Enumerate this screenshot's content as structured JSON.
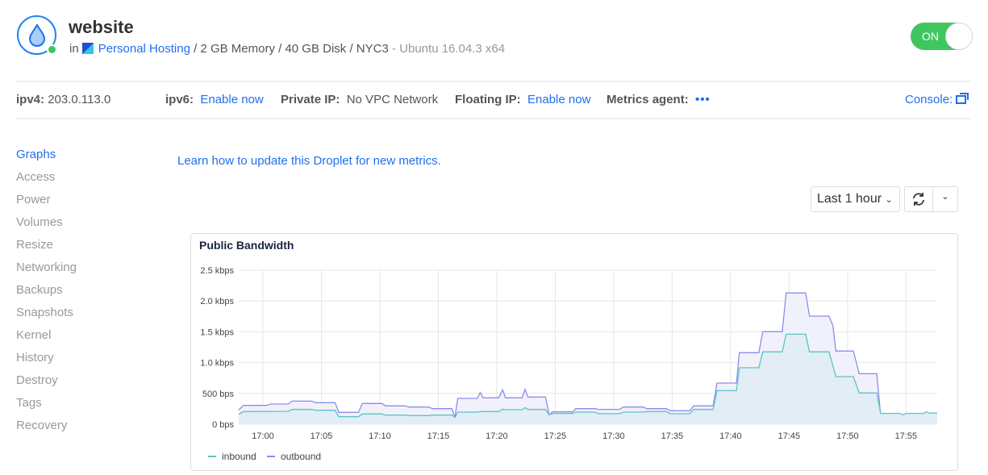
{
  "droplet": {
    "name": "website",
    "in_label": "in",
    "project": "Personal Hosting",
    "specs": "/ 2 GB Memory / 40 GB Disk / NYC3",
    "os": "- Ubuntu 16.04.3 x64",
    "power_toggle": "ON",
    "status_color": "#3fc65f"
  },
  "info": {
    "ipv4_label": "ipv4:",
    "ipv4": "203.0.113.0",
    "ipv6_label": "ipv6:",
    "ipv6_action": "Enable now",
    "private_label": "Private IP:",
    "private_value": "No VPC Network",
    "floating_label": "Floating IP:",
    "floating_action": "Enable now",
    "metrics_label": "Metrics agent:",
    "metrics_value": "•••",
    "console_label": "Console:"
  },
  "sidebar": {
    "items": [
      {
        "label": "Graphs",
        "active": true
      },
      {
        "label": "Access"
      },
      {
        "label": "Power"
      },
      {
        "label": "Volumes"
      },
      {
        "label": "Resize"
      },
      {
        "label": "Networking"
      },
      {
        "label": "Backups"
      },
      {
        "label": "Snapshots"
      },
      {
        "label": "Kernel"
      },
      {
        "label": "History"
      },
      {
        "label": "Destroy"
      },
      {
        "label": "Tags"
      },
      {
        "label": "Recovery"
      }
    ]
  },
  "main": {
    "learn_link": "Learn how to update this Droplet for new metrics.",
    "time_range": "Last 1 hour"
  },
  "chart_data": {
    "type": "area",
    "title": "Public Bandwidth",
    "grid": true,
    "legend": "bottom-left",
    "ylim": [
      0,
      2500
    ],
    "yticks": [
      0,
      500,
      1000,
      1500,
      2000,
      2500
    ],
    "ytick_labels": [
      "0 bps",
      "500 bps",
      "1.0 kbps",
      "1.5 kbps",
      "2.0 kbps",
      "2.5 kbps"
    ],
    "xlim": [
      "16:57:56",
      "17:57:40"
    ],
    "xticks": [
      "17:00",
      "17:05",
      "17:10",
      "17:15",
      "17:20",
      "17:25",
      "17:30",
      "17:35",
      "17:40",
      "17:45",
      "17:50",
      "17:55"
    ],
    "series": [
      {
        "name": "outbound",
        "color": "#8c8cf0",
        "fill": "#f1f1fb",
        "points": [
          [
            "16:57:56",
            231
          ],
          [
            "16:58:20",
            305
          ],
          [
            "17:00:20",
            305
          ],
          [
            "17:00:40",
            327
          ],
          [
            "17:02:10",
            327
          ],
          [
            "17:02:30",
            375
          ],
          [
            "17:04:10",
            375
          ],
          [
            "17:04:30",
            349
          ],
          [
            "17:06:10",
            349
          ],
          [
            "17:06:30",
            192
          ],
          [
            "17:08:10",
            192
          ],
          [
            "17:08:30",
            336
          ],
          [
            "17:10:10",
            336
          ],
          [
            "17:10:30",
            297
          ],
          [
            "17:12:10",
            297
          ],
          [
            "17:12:30",
            279
          ],
          [
            "17:14:10",
            279
          ],
          [
            "17:14:30",
            253
          ],
          [
            "17:16:10",
            253
          ],
          [
            "17:16:25",
            110
          ],
          [
            "17:16:40",
            419
          ],
          [
            "17:18:20",
            419
          ],
          [
            "17:18:35",
            515
          ],
          [
            "17:18:50",
            428
          ],
          [
            "17:20:10",
            428
          ],
          [
            "17:20:30",
            558
          ],
          [
            "17:20:45",
            428
          ],
          [
            "17:22:10",
            428
          ],
          [
            "17:22:25",
            565
          ],
          [
            "17:22:40",
            441
          ],
          [
            "17:24:10",
            441
          ],
          [
            "17:24:30",
            144
          ],
          [
            "17:24:45",
            200
          ],
          [
            "17:26:30",
            200
          ],
          [
            "17:26:45",
            253
          ],
          [
            "17:28:25",
            253
          ],
          [
            "17:28:40",
            241
          ],
          [
            "17:30:30",
            241
          ],
          [
            "17:30:50",
            279
          ],
          [
            "17:32:30",
            279
          ],
          [
            "17:32:50",
            253
          ],
          [
            "17:34:30",
            253
          ],
          [
            "17:34:50",
            218
          ],
          [
            "17:36:30",
            218
          ],
          [
            "17:36:50",
            297
          ],
          [
            "17:38:30",
            297
          ],
          [
            "17:38:50",
            667
          ],
          [
            "17:40:30",
            667
          ],
          [
            "17:40:45",
            1161
          ],
          [
            "17:42:25",
            1161
          ],
          [
            "17:42:45",
            1501
          ],
          [
            "17:44:25",
            1501
          ],
          [
            "17:44:45",
            2129
          ],
          [
            "17:46:25",
            2129
          ],
          [
            "17:46:45",
            1754
          ],
          [
            "17:48:25",
            1754
          ],
          [
            "17:48:45",
            1600
          ],
          [
            "17:49:00",
            1187
          ],
          [
            "17:50:30",
            1187
          ],
          [
            "17:51:00",
            820
          ],
          [
            "17:52:30",
            820
          ],
          [
            "17:52:50",
            135
          ],
          [
            "17:54:30",
            135
          ],
          [
            "17:54:45",
            65
          ],
          [
            "17:55:00",
            100
          ],
          [
            "17:56:30",
            100
          ],
          [
            "17:56:45",
            135
          ],
          [
            "17:57:40",
            135
          ]
        ]
      },
      {
        "name": "inbound",
        "color": "#5cc5c0",
        "fill": "#e2edf5",
        "points": [
          [
            "16:57:56",
            160
          ],
          [
            "16:58:20",
            205
          ],
          [
            "17:02:10",
            210
          ],
          [
            "17:02:30",
            240
          ],
          [
            "17:04:10",
            240
          ],
          [
            "17:04:30",
            227
          ],
          [
            "17:06:10",
            227
          ],
          [
            "17:06:30",
            122
          ],
          [
            "17:08:10",
            122
          ],
          [
            "17:08:30",
            166
          ],
          [
            "17:10:10",
            166
          ],
          [
            "17:10:30",
            148
          ],
          [
            "17:12:10",
            148
          ],
          [
            "17:12:30",
            140
          ],
          [
            "17:14:10",
            140
          ],
          [
            "17:14:30",
            148
          ],
          [
            "17:16:10",
            148
          ],
          [
            "17:16:25",
            110
          ],
          [
            "17:16:40",
            196
          ],
          [
            "17:18:20",
            196
          ],
          [
            "17:18:40",
            205
          ],
          [
            "17:20:10",
            205
          ],
          [
            "17:20:30",
            245
          ],
          [
            "17:20:45",
            235
          ],
          [
            "17:22:10",
            235
          ],
          [
            "17:22:25",
            270
          ],
          [
            "17:22:40",
            240
          ],
          [
            "17:24:10",
            240
          ],
          [
            "17:24:30",
            150
          ],
          [
            "17:24:45",
            175
          ],
          [
            "17:26:30",
            175
          ],
          [
            "17:26:45",
            196
          ],
          [
            "17:28:25",
            196
          ],
          [
            "17:28:40",
            170
          ],
          [
            "17:30:30",
            170
          ],
          [
            "17:30:50",
            196
          ],
          [
            "17:32:30",
            196
          ],
          [
            "17:32:50",
            205
          ],
          [
            "17:34:30",
            205
          ],
          [
            "17:34:50",
            170
          ],
          [
            "17:36:30",
            170
          ],
          [
            "17:36:50",
            240
          ],
          [
            "17:38:30",
            240
          ],
          [
            "17:38:50",
            545
          ],
          [
            "17:40:30",
            545
          ],
          [
            "17:40:45",
            916
          ],
          [
            "17:42:25",
            916
          ],
          [
            "17:42:45",
            1174
          ],
          [
            "17:44:25",
            1174
          ],
          [
            "17:44:45",
            1461
          ],
          [
            "17:46:25",
            1461
          ],
          [
            "17:46:45",
            1174
          ],
          [
            "17:48:25",
            1174
          ],
          [
            "17:49:00",
            772
          ],
          [
            "17:50:30",
            772
          ],
          [
            "17:51:00",
            506
          ],
          [
            "17:52:30",
            506
          ],
          [
            "17:52:50",
            175
          ],
          [
            "17:54:30",
            175
          ],
          [
            "17:54:45",
            150
          ],
          [
            "17:55:00",
            175
          ],
          [
            "17:56:30",
            175
          ],
          [
            "17:56:45",
            200
          ],
          [
            "17:57:00",
            180
          ],
          [
            "17:57:40",
            180
          ]
        ]
      }
    ]
  }
}
